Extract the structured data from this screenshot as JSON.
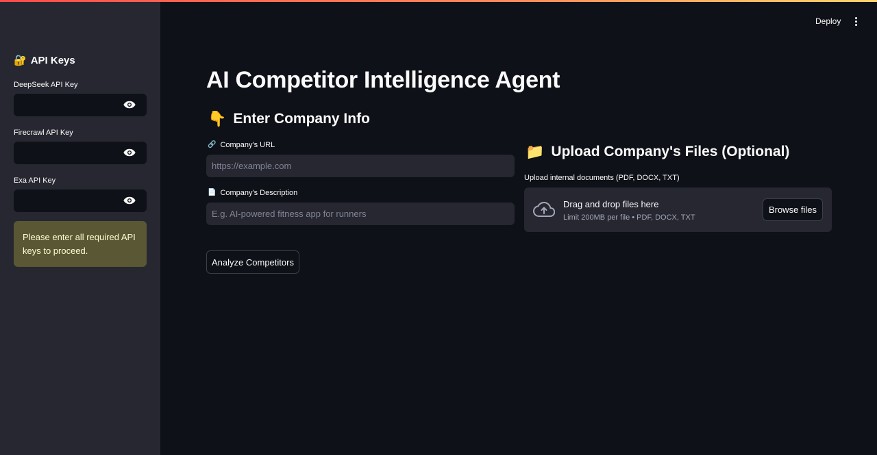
{
  "header": {
    "deploy_label": "Deploy",
    "menu_icon": "kebab-menu-icon"
  },
  "sidebar": {
    "title": "API Keys",
    "title_icon": "🔐",
    "fields": [
      {
        "label": "DeepSeek API Key",
        "value": ""
      },
      {
        "label": "Firecrawl API Key",
        "value": ""
      },
      {
        "label": "Exa API Key",
        "value": ""
      }
    ],
    "warning": "Please enter all required API keys to proceed."
  },
  "main": {
    "title": "AI Competitor Intelligence Agent",
    "company_section": {
      "title": "Enter Company Info",
      "icon": "👇",
      "url_label": "Company's URL",
      "url_icon": "🔗",
      "url_placeholder": "https://example.com",
      "desc_label": "Company's Description",
      "desc_icon": "📄",
      "desc_placeholder": "E.g. AI-powered fitness app for runners",
      "analyze_label": "Analyze Competitors"
    },
    "upload_section": {
      "title": "Upload Company's Files (Optional)",
      "icon": "📁",
      "label": "Upload internal documents (PDF, DOCX, TXT)",
      "drop_title": "Drag and drop files here",
      "drop_sub": "Limit 200MB per file • PDF, DOCX, TXT",
      "browse_label": "Browse files"
    }
  },
  "colors": {
    "background": "#0e1117",
    "sidebar": "#262730",
    "input": "#262730",
    "warning_bg": "#5a5834",
    "warning_text": "#fffcd4",
    "accent_gradient_start": "#ff4b4b",
    "accent_gradient_end": "#ffd36b"
  }
}
